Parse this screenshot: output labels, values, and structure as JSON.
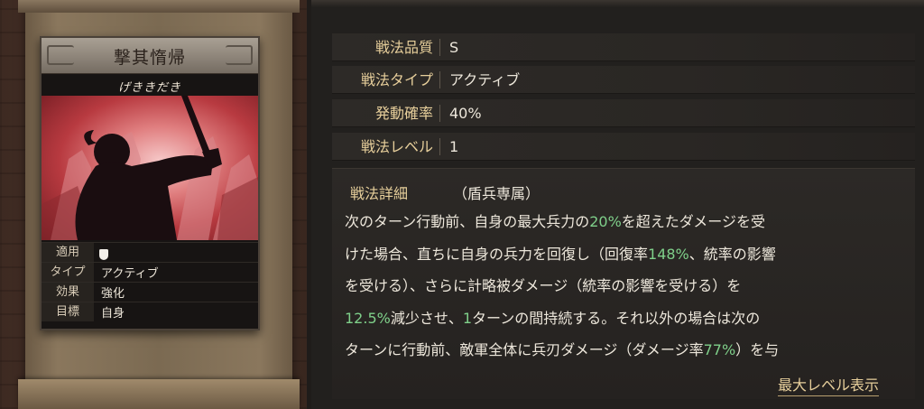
{
  "card": {
    "title": "撃其惰帰",
    "reading": "げききだき",
    "info": [
      {
        "key": "適用",
        "value": "",
        "icon": "shield-icon"
      },
      {
        "key": "タイプ",
        "value": "アクティブ"
      },
      {
        "key": "効果",
        "value": "強化"
      },
      {
        "key": "目標",
        "value": "自身"
      }
    ]
  },
  "stats": [
    {
      "key": "戦法品質",
      "value": "S"
    },
    {
      "key": "戦法タイプ",
      "value": "アクティブ"
    },
    {
      "key": "発動確率",
      "value": "40%"
    },
    {
      "key": "戦法レベル",
      "value": "1"
    }
  ],
  "detail": {
    "key": "戦法詳細",
    "tag": "（盾兵専属）",
    "lines": [
      [
        {
          "t": "次のターン行動前、自身の最大兵力の"
        },
        {
          "t": "20%",
          "g": true
        },
        {
          "t": "を超えたダメージを受"
        }
      ],
      [
        {
          "t": "けた場合、直ちに自身の兵力を回復し（回復率"
        },
        {
          "t": "148%",
          "g": true
        },
        {
          "t": "、統率の影響"
        }
      ],
      [
        {
          "t": "を受ける）、さらに計略被ダメージ（統率の影響を受ける）を"
        }
      ],
      [
        {
          "t": "12.5%",
          "g": true
        },
        {
          "t": "減少させ、"
        },
        {
          "t": "1",
          "g": true
        },
        {
          "t": "ターンの間持続する。それ以外の場合は次の"
        }
      ],
      [
        {
          "t": "ターンに行動前、敵軍全体に兵刃ダメージ（ダメージ率"
        },
        {
          "t": "77%",
          "g": true
        },
        {
          "t": "）を与"
        }
      ]
    ]
  },
  "max_level_link": "最大レベル表示",
  "colors": {
    "accent_gold": "#e7cf9b",
    "highlight_green": "#7fd08a",
    "card_red": "#b83a40"
  }
}
